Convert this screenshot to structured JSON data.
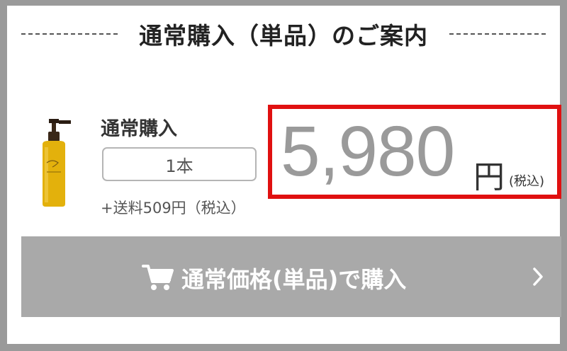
{
  "header": {
    "title": "通常購入（単品）のご案内"
  },
  "product": {
    "purchase_label": "通常購入",
    "quantity": "1本",
    "shipping_note": "+送料509円（税込）",
    "price": "5,980",
    "currency": "円",
    "tax_note": "(税込)"
  },
  "buy_button": {
    "label": "通常価格(単品)で購入",
    "icon": "cart-icon",
    "chevron_icon": "chevron-right-icon"
  },
  "colors": {
    "frame": "#9a9a9a",
    "highlight_border": "#e01010",
    "button_bg": "#a9a9a9",
    "price_text": "#9a9a9a",
    "bottle_liquid": "#e3b10c"
  }
}
